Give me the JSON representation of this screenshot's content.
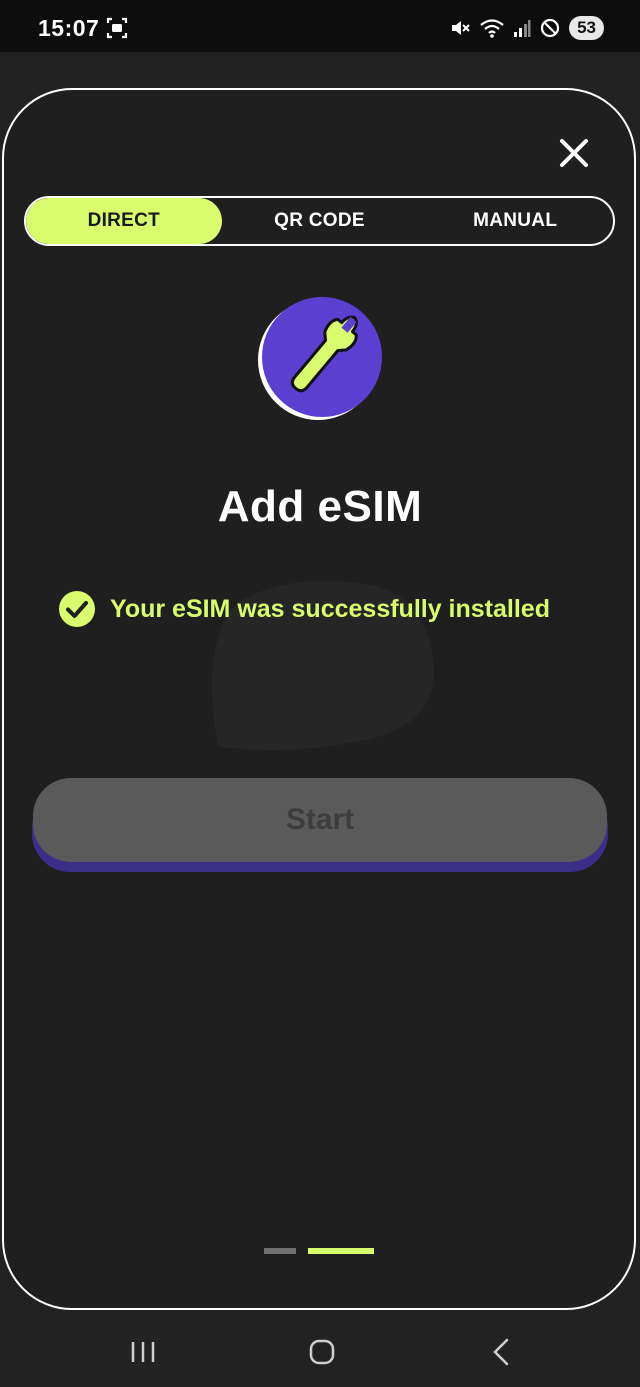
{
  "status_bar": {
    "time": "15:07",
    "battery": "53",
    "icons": [
      "screenshot-icon",
      "mute-icon",
      "wifi-icon",
      "signal-icon",
      "do-not-disturb-icon"
    ]
  },
  "sheet": {
    "tabs": [
      {
        "label": "DIRECT",
        "active": true
      },
      {
        "label": "QR CODE",
        "active": false
      },
      {
        "label": "MANUAL",
        "active": false
      }
    ],
    "title": "Add eSIM",
    "success_message": "Your eSIM was successfully installed",
    "start_label": "Start",
    "pager": {
      "total": 2,
      "current": 2
    }
  },
  "colors": {
    "accent": "#d9fb6e",
    "purple": "#5b3fd1",
    "background": "#1f1f1f"
  },
  "nav": [
    "recents-icon",
    "home-icon",
    "back-icon"
  ]
}
